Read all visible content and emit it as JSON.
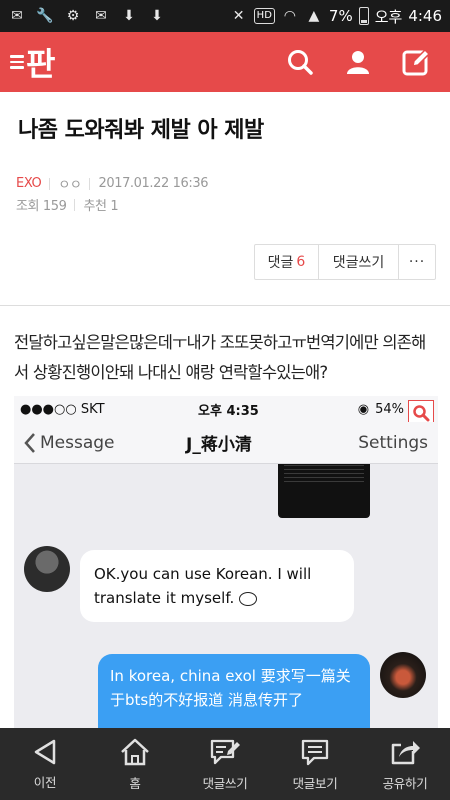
{
  "status_bar": {
    "hd": "HD",
    "battery": "7%",
    "ampm": "오후",
    "time": "4:46"
  },
  "app": {
    "logo": "판",
    "accent": "#e64a4a"
  },
  "article": {
    "title": "나좀 도와줘봐 제발 아 제발",
    "category": "EXO",
    "author": "ㅇㅇ",
    "date": "2017.01.22 16:36",
    "views": "조회 159",
    "recommends": "추천 1",
    "body": "전달하고싶은말은많은데ㅜ내가 조또못하고ㅠ번역기에만 의존해서 상황진행이안돼 나대신 얘랑 연락할수있는애?"
  },
  "actions": {
    "comment_label": "댓글",
    "comment_count": "6",
    "write_label": "댓글쓰기",
    "more": "···"
  },
  "embedded": {
    "carrier": "●●●○○ SKT",
    "time": "오후 4:35",
    "battery": "54%",
    "back_label": "Message",
    "contact": "J_蒋小清",
    "settings": "Settings",
    "msg_in": "OK.you can use Korean. I will translate it myself.",
    "msg_out": "In korea, china exol 要求写一篇关于bts的不好报道 消息传开了"
  },
  "bottom_nav": [
    {
      "label": "이전",
      "icon": "back-triangle-icon"
    },
    {
      "label": "홈",
      "icon": "home-icon"
    },
    {
      "label": "댓글쓰기",
      "icon": "comment-write-icon"
    },
    {
      "label": "댓글보기",
      "icon": "comment-view-icon"
    },
    {
      "label": "공유하기",
      "icon": "share-icon"
    }
  ]
}
